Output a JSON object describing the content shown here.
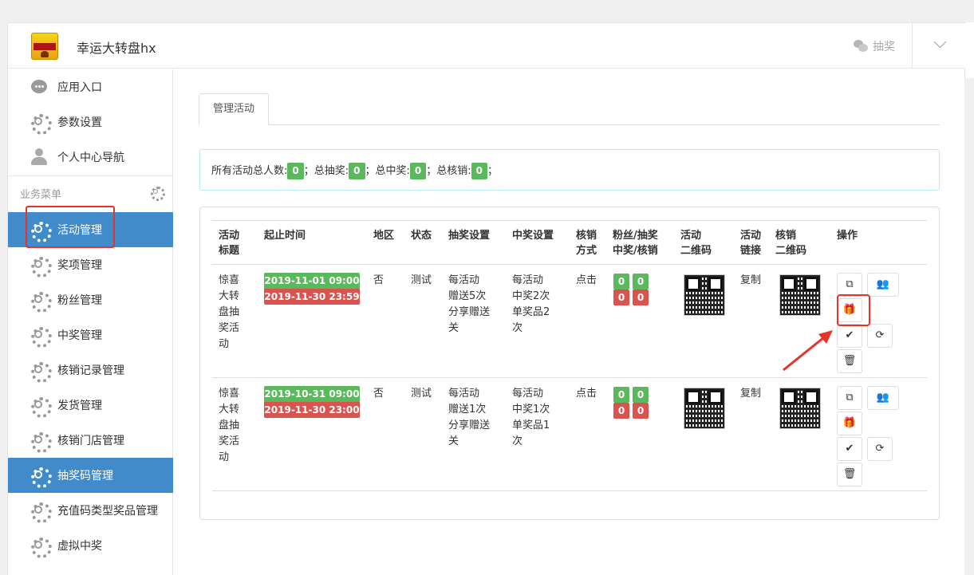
{
  "app": {
    "title": "幸运大转盘hx",
    "header_right_label": "抽奖"
  },
  "sidebar": {
    "top_items": [
      {
        "label": "应用入口",
        "icon": "chat-icon"
      },
      {
        "label": "参数设置",
        "icon": "gear-icon"
      },
      {
        "label": "个人中心导航",
        "icon": "user-icon"
      }
    ],
    "section_title": "业务菜单",
    "items": [
      {
        "label": "活动管理",
        "active": true
      },
      {
        "label": "奖项管理"
      },
      {
        "label": "粉丝管理"
      },
      {
        "label": "中奖管理"
      },
      {
        "label": "核销记录管理"
      },
      {
        "label": "发货管理"
      },
      {
        "label": "核销门店管理"
      },
      {
        "label": "抽奖码管理",
        "active": true
      },
      {
        "label": "充值码类型奖品管理"
      },
      {
        "label": "虚拟中奖"
      }
    ]
  },
  "main": {
    "tab": "管理活动",
    "summary": {
      "total_people_label": "所有活动总人数:",
      "total_people": "0",
      "total_draw_label": "；总抽奖:",
      "total_draw": "0",
      "total_win_label": "；总中奖:",
      "total_win": "0",
      "total_verify_label": "；总核销:",
      "total_verify": "0",
      "end": "；"
    },
    "table": {
      "headers": {
        "title": "活动\n标题",
        "time": "起止时间",
        "region": "地区",
        "status": "状态",
        "draw": "抽奖设置",
        "win": "中奖设置",
        "verify": "核销\n方式",
        "fans": "粉丝/抽奖\n中奖/核销",
        "qr": "活动\n二维码",
        "link": "活动\n链接",
        "vqr": "核销\n二维码",
        "ops": "操作"
      },
      "rows": [
        {
          "title": "惊喜\n大转\n盘抽\n奖活\n动",
          "start": "2019-11-01 09:00",
          "end": "2019-11-30 23:59",
          "region": "否",
          "status": "测试",
          "draw": "每活动\n赠送5次\n分享赠送\n关",
          "win": "每活动\n中奖2次\n单奖品2\n次",
          "verify": "点击",
          "fans": "0",
          "draws": "0",
          "wins": "0",
          "verifies": "0",
          "link": "复制"
        },
        {
          "title": "惊喜\n大转\n盘抽\n奖活\n动",
          "start": "2019-10-31 09:00",
          "end": "2019-11-30 23:00",
          "region": "否",
          "status": "测试",
          "draw": "每活动\n赠送1次\n分享赠送\n关",
          "win": "每活动\n中奖1次\n单奖品1\n次",
          "verify": "点击",
          "fans": "0",
          "draws": "0",
          "wins": "0",
          "verifies": "0",
          "link": "复制"
        }
      ]
    }
  },
  "colors": {
    "primary": "#428bca",
    "success": "#5cb85c",
    "danger": "#d9534f",
    "highlight": "#e8332a"
  }
}
